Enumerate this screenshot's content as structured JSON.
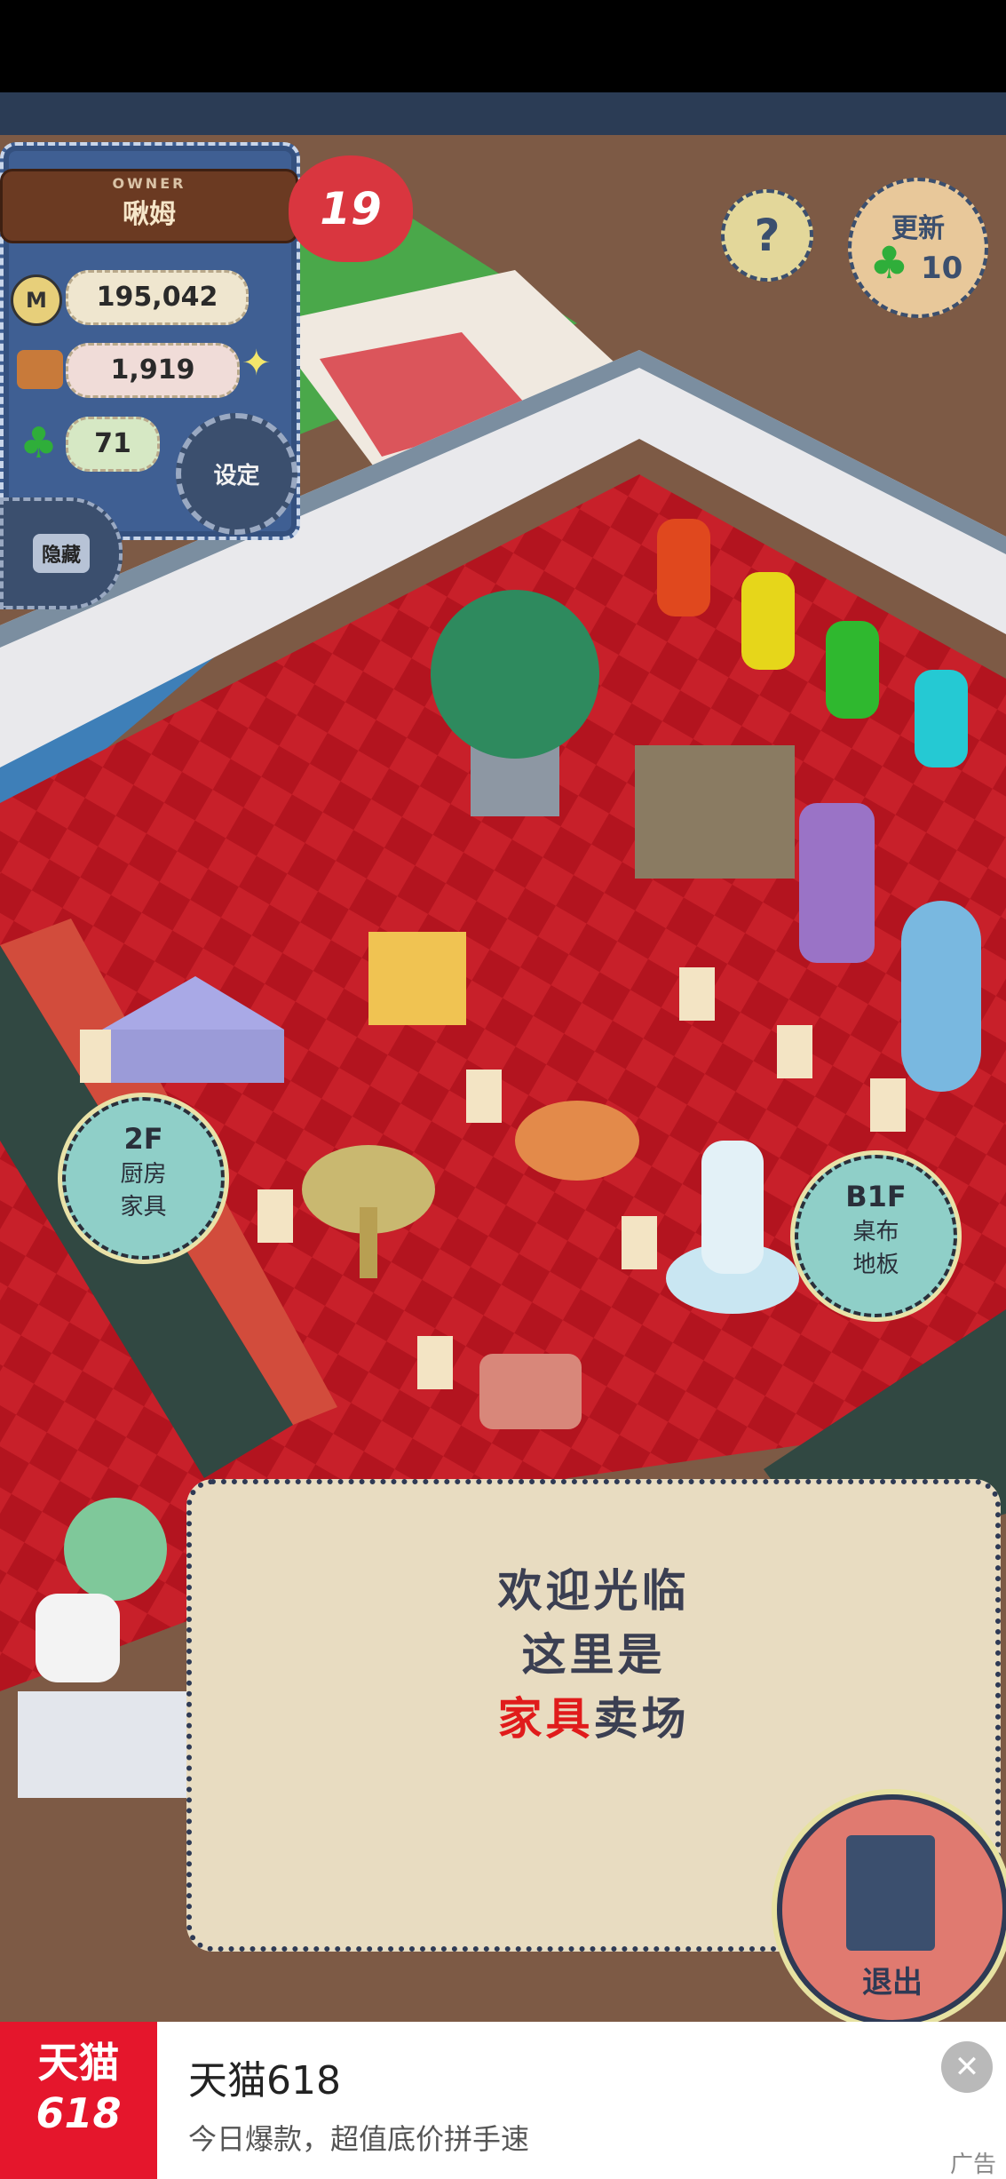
{
  "owner": {
    "label": "OWNER",
    "name": "啾姆",
    "level": "19",
    "coins": "195,042",
    "goods": "1,919",
    "clovers": "71"
  },
  "buttons": {
    "help": "?",
    "refresh_label": "更新",
    "refresh_cost": "10",
    "settings": "设定",
    "hide": "隐藏",
    "exit": "退出"
  },
  "floors": {
    "up": {
      "floor": "2F",
      "line1": "厨房",
      "line2": "家具"
    },
    "down": {
      "floor": "B1F",
      "line1": "桌布",
      "line2": "地板"
    }
  },
  "dialog": {
    "line1": "欢迎光临",
    "line2": "这里是",
    "highlight": "家具",
    "line3_suffix": "卖场"
  },
  "ad": {
    "logo_top": "天猫",
    "logo_bottom": "618",
    "title": "天猫618",
    "subtitle": "今日爆款，超值底价拼手速",
    "tag": "广告"
  },
  "colors": {
    "carpet": "#c8202a",
    "highlight_text": "#e01b1b",
    "ad_brand": "#e5162c"
  }
}
